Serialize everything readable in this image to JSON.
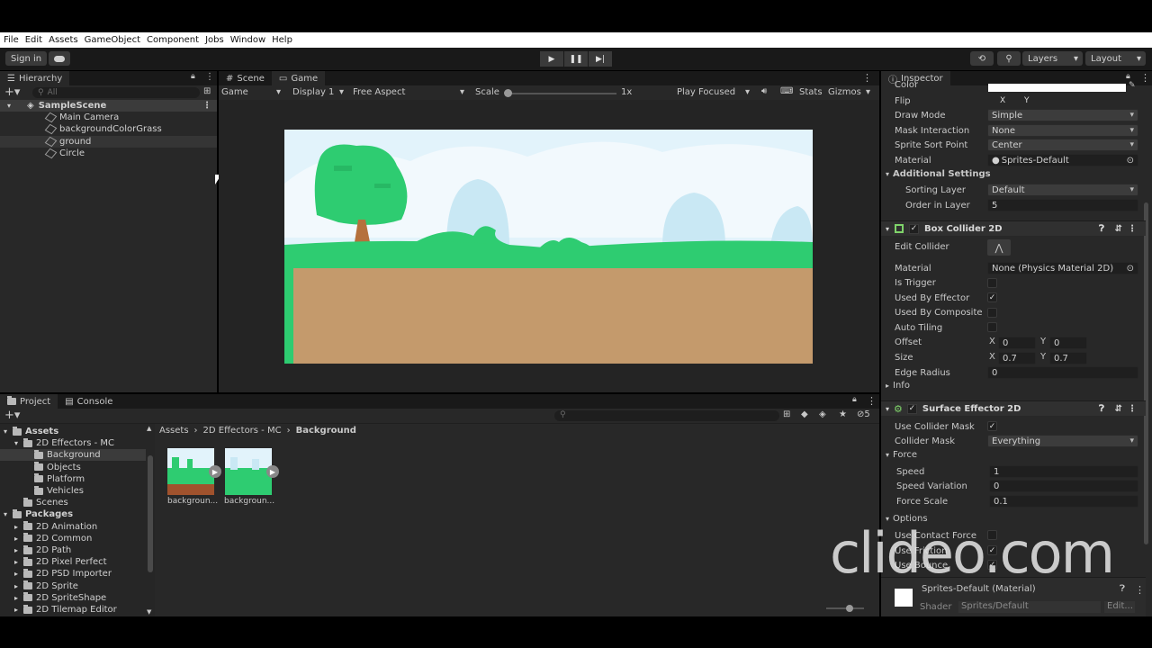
{
  "menu": [
    "File",
    "Edit",
    "Assets",
    "GameObject",
    "Component",
    "Jobs",
    "Window",
    "Help"
  ],
  "toolbar": {
    "sign_in": "Sign in",
    "layers": "Layers",
    "layout": "Layout"
  },
  "hierarchy": {
    "tab": "Hierarchy",
    "search_placeholder": "All",
    "scene": "SampleScene",
    "items": [
      "Main Camera",
      "backgroundColorGrass",
      "ground",
      "Circle"
    ]
  },
  "sceneview": {
    "tabs": [
      "Scene",
      "Game"
    ],
    "game_dropdown": "Game",
    "display": "Display 1",
    "aspect": "Free Aspect",
    "scale_label": "Scale",
    "scale_value": "1x",
    "play_focused": "Play Focused",
    "stats": "Stats",
    "gizmos": "Gizmos"
  },
  "inspector": {
    "tab": "Inspector",
    "color_label": "Color",
    "flip_label": "Flip",
    "flip_x": "X",
    "flip_y": "Y",
    "draw_mode_label": "Draw Mode",
    "draw_mode": "Simple",
    "mask_label": "Mask Interaction",
    "mask": "None",
    "sort_point_label": "Sprite Sort Point",
    "sort_point": "Center",
    "material_label": "Material",
    "material": "Sprites-Default",
    "additional_settings": "Additional Settings",
    "sorting_layer_label": "Sorting Layer",
    "sorting_layer": "Default",
    "order_label": "Order in Layer",
    "order": "5",
    "box_collider": {
      "title": "Box Collider 2D",
      "edit_collider": "Edit Collider",
      "material_label": "Material",
      "material": "None (Physics Material 2D)",
      "is_trigger": "Is Trigger",
      "used_by_effector": "Used By Effector",
      "used_by_composite": "Used By Composite",
      "auto_tiling": "Auto Tiling",
      "offset_label": "Offset",
      "offset_x": "0",
      "offset_y": "0",
      "size_label": "Size",
      "size_x": "0.7",
      "size_y": "0.7",
      "edge_radius_label": "Edge Radius",
      "edge_radius": "0",
      "info": "Info"
    },
    "surface_effector": {
      "title": "Surface Effector 2D",
      "use_collider_mask": "Use Collider Mask",
      "collider_mask_label": "Collider Mask",
      "collider_mask": "Everything",
      "force": "Force",
      "speed_label": "Speed",
      "speed": "1",
      "speed_variation_label": "Speed Variation",
      "speed_variation": "0",
      "force_scale_label": "Force Scale",
      "force_scale": "0.1",
      "options": "Options",
      "use_contact_force": "Use Contact Force",
      "use_friction": "Use Friction",
      "use_bounce": "Use Bounce"
    },
    "material_footer": {
      "name": "Sprites-Default (Material)",
      "shader_label": "Shader",
      "shader": "Sprites/Default",
      "edit": "Edit..."
    },
    "axis_x": "X",
    "axis_y": "Y"
  },
  "project": {
    "tabs": [
      "Project",
      "Console"
    ],
    "breadcrumb": [
      "Assets",
      "2D Effectors - MC",
      "Background"
    ],
    "hidden_count": "5",
    "tree": [
      {
        "label": "Assets",
        "depth": 0,
        "bold": true
      },
      {
        "label": "2D Effectors - MC",
        "depth": 1
      },
      {
        "label": "Background",
        "depth": 2,
        "selected": true
      },
      {
        "label": "Objects",
        "depth": 2
      },
      {
        "label": "Platform",
        "depth": 2
      },
      {
        "label": "Vehicles",
        "depth": 2
      },
      {
        "label": "Scenes",
        "depth": 1
      },
      {
        "label": "Packages",
        "depth": 0,
        "bold": true
      },
      {
        "label": "2D Animation",
        "depth": 1
      },
      {
        "label": "2D Common",
        "depth": 1
      },
      {
        "label": "2D Path",
        "depth": 1
      },
      {
        "label": "2D Pixel Perfect",
        "depth": 1
      },
      {
        "label": "2D PSD Importer",
        "depth": 1
      },
      {
        "label": "2D Sprite",
        "depth": 1
      },
      {
        "label": "2D SpriteShape",
        "depth": 1
      },
      {
        "label": "2D Tilemap Editor",
        "depth": 1
      }
    ],
    "assets": [
      "backgroun...",
      "backgroun..."
    ]
  },
  "watermark": "clideo.com",
  "colors": {
    "grass": "#2ecc71",
    "dirt": "#c49a6c",
    "sky": "#dff2fa",
    "panel": "#282828",
    "accent": "#3a72b0"
  }
}
